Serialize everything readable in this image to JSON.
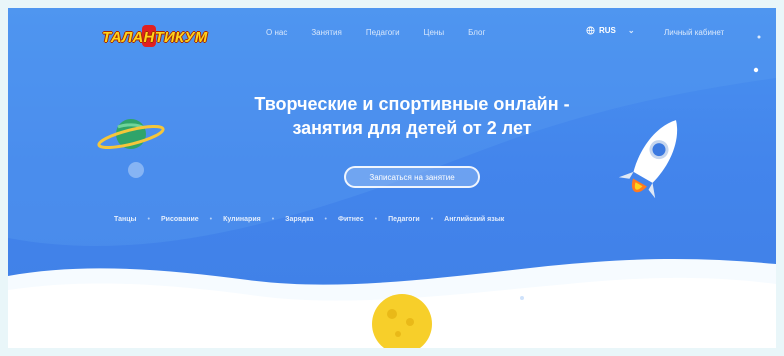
{
  "header": {
    "logo_text": "ТАЛАНТИКУМ",
    "nav": [
      {
        "label": "О нас"
      },
      {
        "label": "Занятия"
      },
      {
        "label": "Педагоги"
      },
      {
        "label": "Цены"
      },
      {
        "label": "Блог"
      }
    ],
    "language": "RUS",
    "account_link": "Личный кабинет"
  },
  "hero": {
    "title_line1": "Творческие и спортивные онлайн -",
    "title_line2": "занятия для детей от 2 лет",
    "cta_label": "Записаться на занятие"
  },
  "categories": [
    {
      "label": "Танцы"
    },
    {
      "label": "Рисование"
    },
    {
      "label": "Кулинария"
    },
    {
      "label": "Зарядка"
    },
    {
      "label": "Фитнес"
    },
    {
      "label": "Педагоги"
    },
    {
      "label": "Английский язык"
    }
  ],
  "colors": {
    "background": "#4385ec",
    "accent": "#ffd31a",
    "logo_red": "#e02020",
    "wave": "#5a9ef2"
  },
  "icons": [
    "planet-icon",
    "rocket-icon",
    "star-icon",
    "moon-icon",
    "chevron-down-icon",
    "globe-icon"
  ]
}
